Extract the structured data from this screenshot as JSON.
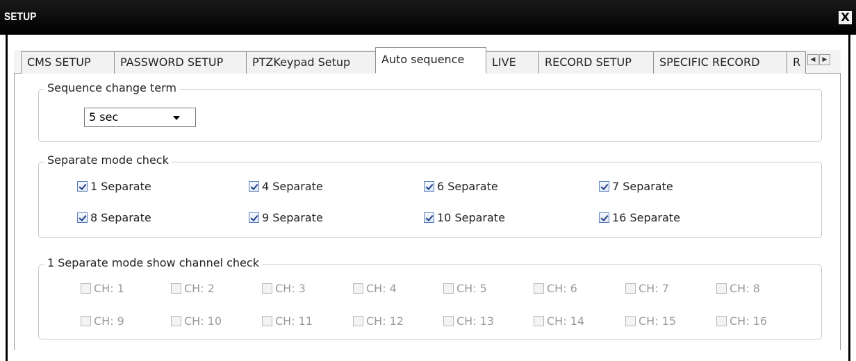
{
  "window": {
    "title": "SETUP",
    "close_label": "X"
  },
  "tabs": [
    {
      "label": "CMS SETUP",
      "active": false
    },
    {
      "label": "PASSWORD SETUP",
      "active": false
    },
    {
      "label": "PTZKeypad Setup",
      "active": false
    },
    {
      "label": "Auto sequence",
      "active": true
    },
    {
      "label": "LIVE",
      "active": false
    },
    {
      "label": "RECORD SETUP",
      "active": false
    },
    {
      "label": "SPECIFIC RECORD",
      "active": false
    },
    {
      "label": "R",
      "active": false
    }
  ],
  "tab_scroll": {
    "left_icon": "arrow-left-icon",
    "right_icon": "arrow-right-icon"
  },
  "sequence_change": {
    "group_label": "Sequence change term",
    "selected": "5 sec"
  },
  "separate_mode": {
    "group_label": "Separate mode check",
    "items": [
      {
        "label": "1 Separate",
        "checked": true
      },
      {
        "label": "4 Separate",
        "checked": true
      },
      {
        "label": "6 Separate",
        "checked": true
      },
      {
        "label": "7 Separate",
        "checked": true
      },
      {
        "label": "8 Separate",
        "checked": true
      },
      {
        "label": "9 Separate",
        "checked": true
      },
      {
        "label": "10 Separate",
        "checked": true
      },
      {
        "label": "16 Separate",
        "checked": true
      }
    ]
  },
  "channel_check": {
    "group_label": "1 Separate mode show channel check",
    "enabled": false,
    "channels": [
      {
        "label": "CH: 1",
        "checked": false
      },
      {
        "label": "CH: 2",
        "checked": false
      },
      {
        "label": "CH: 3",
        "checked": false
      },
      {
        "label": "CH: 4",
        "checked": false
      },
      {
        "label": "CH: 5",
        "checked": false
      },
      {
        "label": "CH: 6",
        "checked": false
      },
      {
        "label": "CH: 7",
        "checked": false
      },
      {
        "label": "CH: 8",
        "checked": false
      },
      {
        "label": "CH: 9",
        "checked": false
      },
      {
        "label": "CH: 10",
        "checked": false
      },
      {
        "label": "CH: 11",
        "checked": false
      },
      {
        "label": "CH: 12",
        "checked": false
      },
      {
        "label": "CH: 13",
        "checked": false
      },
      {
        "label": "CH: 14",
        "checked": false
      },
      {
        "label": "CH: 15",
        "checked": false
      },
      {
        "label": "CH: 16",
        "checked": false
      }
    ]
  }
}
